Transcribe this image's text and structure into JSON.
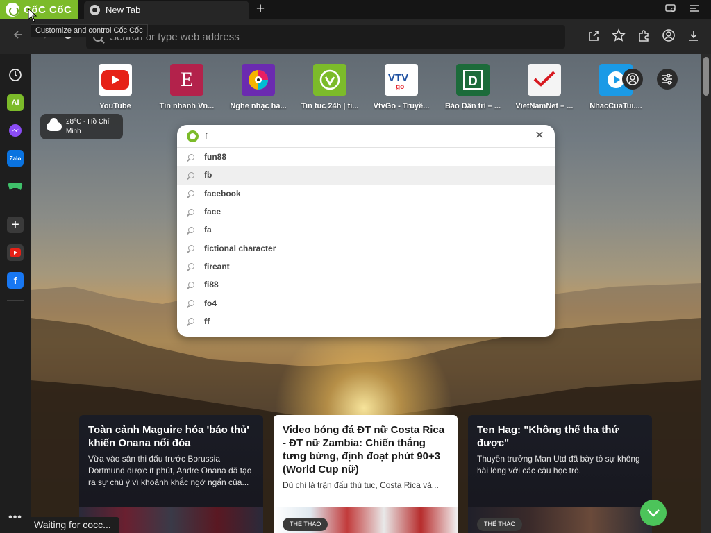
{
  "brand": {
    "name": "CốC CốC"
  },
  "tab": {
    "title": "New Tab",
    "new_tab": "+"
  },
  "tooltip": "Customize and control Cốc Cốc",
  "omnibox": {
    "placeholder": "Search or type web address"
  },
  "speed_dial": [
    {
      "label": "YouTube",
      "icon": "youtube-icon",
      "color": "#ffffff"
    },
    {
      "label": "Tin nhanh Vn...",
      "icon": "e-letter-icon",
      "color": "#b3224b"
    },
    {
      "label": "Nghe nhạc ha...",
      "icon": "music-disc-icon",
      "color": "#6b2bb0"
    },
    {
      "label": "Tin tuc 24h | ti...",
      "icon": "check-circle-icon",
      "color": "#7cbb2a"
    },
    {
      "label": "VtvGo - Truyề...",
      "icon": "vtv-icon",
      "color": "#ffffff"
    },
    {
      "label": "Báo Dân trí – ...",
      "icon": "d-letter-icon",
      "color": "#1c6b3a"
    },
    {
      "label": "VietNamNet – ...",
      "icon": "check-mark-icon",
      "color": "#f4f4f4"
    },
    {
      "label": "NhacCuaTui....",
      "icon": "play-icon",
      "color": "#1a9ae6"
    }
  ],
  "weather": {
    "text": "28°C - Hồ Chí Minh"
  },
  "search": {
    "query": "f",
    "suggestions": [
      "fun88",
      "fb",
      "facebook",
      "face",
      "fa",
      "fictional character",
      "fireant",
      "fi88",
      "fo4",
      "ff"
    ],
    "highlighted_index": 1
  },
  "news": [
    {
      "title": "Toàn cảnh Maguire hóa 'báo thủ' khiến Onana nổi đóa",
      "desc": "Vừa vào sân thi đấu trước Borussia Dortmund được ít phút, Andre Onana đã tạo ra sự chú ý vì khoảnh khắc ngớ ngẩn của...",
      "tag": ""
    },
    {
      "title": "Video bóng đá ĐT nữ Costa Rica - ĐT nữ Zambia: Chiến thắng tưng bừng, định đoạt phút 90+3 (World Cup nữ)",
      "desc": "Dù chỉ là trận đấu thủ tục, Costa Rica và...",
      "tag": "THỂ THAO"
    },
    {
      "title": "Ten Hag: \"Không thể tha thứ được\"",
      "desc": "Thuyền trưởng Man Utd đã bày tỏ sự không hài lòng với các cậu học trò.",
      "tag": "THỂ THAO"
    }
  ],
  "status_text": "Waiting for cocc...",
  "colors": {
    "brand_green": "#7cbb2a",
    "scroll_top": "#4cc45a"
  }
}
